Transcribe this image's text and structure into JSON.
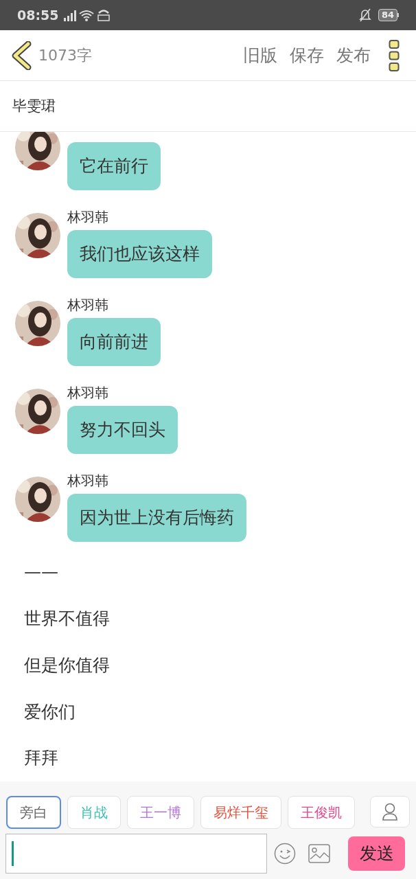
{
  "status_bar": {
    "time": "08:55",
    "battery": "84"
  },
  "header": {
    "word_count": "1073字",
    "actions": [
      "旧版",
      "保存",
      "发布"
    ]
  },
  "title": "毕雯珺",
  "messages": [
    {
      "kind": "chat",
      "text": "它在前行"
    },
    {
      "kind": "chat",
      "name": "林羽韩",
      "text": "我们也应该这样"
    },
    {
      "kind": "chat",
      "name": "林羽韩",
      "text": "向前前进"
    },
    {
      "kind": "chat",
      "name": "林羽韩",
      "text": "努力不回头"
    },
    {
      "kind": "chat",
      "name": "林羽韩",
      "text": "因为世上没有后悔药"
    },
    {
      "kind": "narration",
      "text": "——"
    },
    {
      "kind": "narration",
      "text": "世界不值得"
    },
    {
      "kind": "narration",
      "text": "但是你值得"
    },
    {
      "kind": "narration",
      "text": "爱你们"
    },
    {
      "kind": "narration",
      "text": "拜拜"
    }
  ],
  "roles": [
    {
      "label": "旁白",
      "color": "#666666",
      "selected": true
    },
    {
      "label": "肖战",
      "color": "#3cbfb0",
      "selected": false
    },
    {
      "label": "王一博",
      "color": "#b374dc",
      "selected": false
    },
    {
      "label": "易烊千玺",
      "color": "#e0533c",
      "selected": false
    },
    {
      "label": "王俊凯",
      "color": "#e6488c",
      "selected": false
    }
  ],
  "send_button": "发送"
}
